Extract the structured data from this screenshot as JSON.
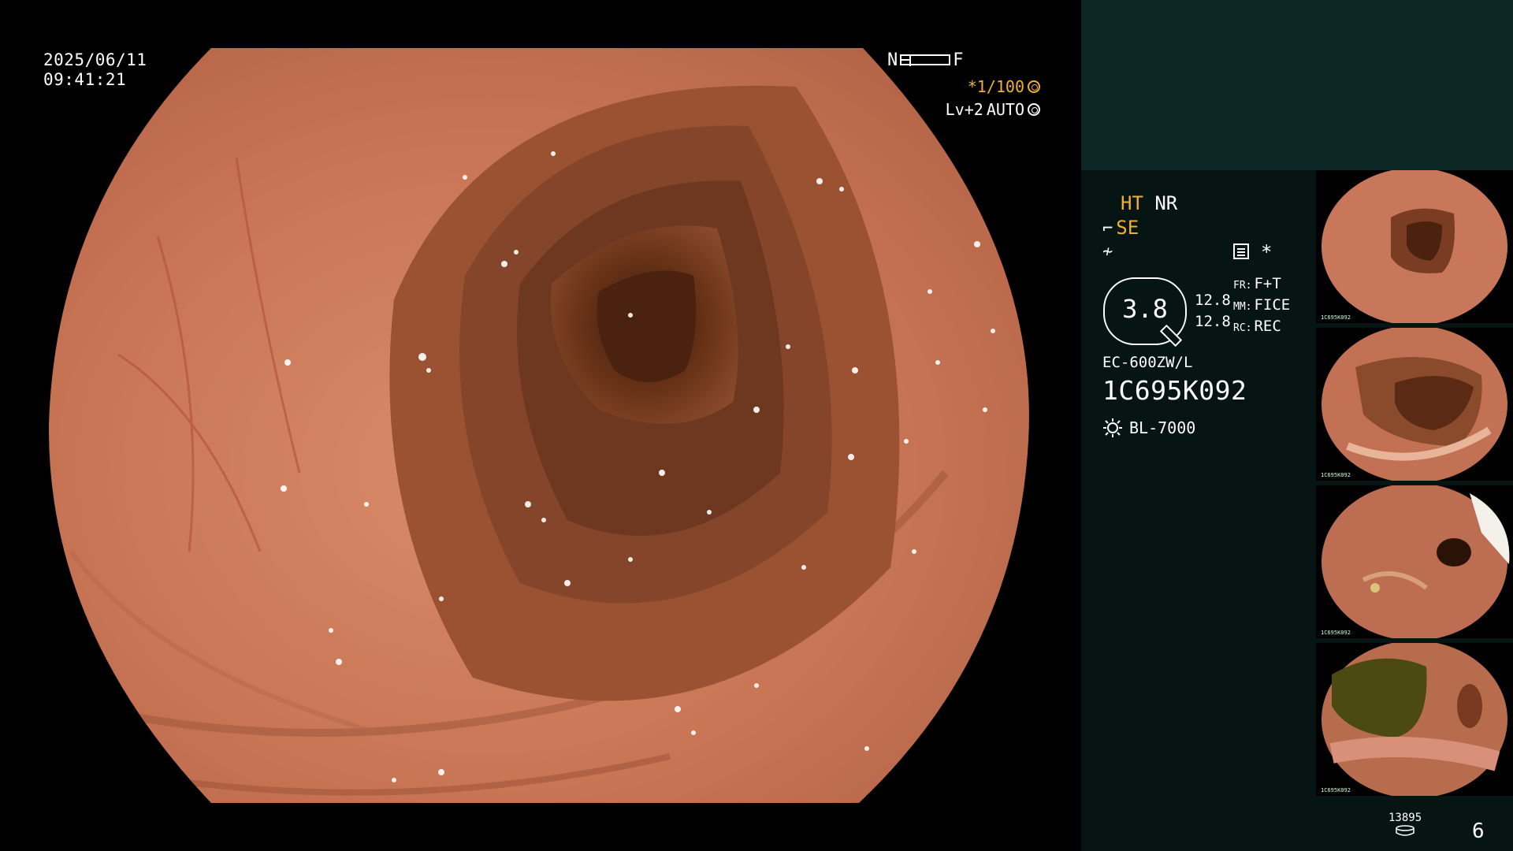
{
  "overlay": {
    "date": "2025/06/11",
    "time": "09:41:21",
    "zoom_near": "N",
    "zoom_far": "F",
    "shutter": "*1/100",
    "level": "Lv+2",
    "exposure_mode": "AUTO"
  },
  "status": {
    "ht": "HT",
    "nr": "NR",
    "se": "SE"
  },
  "gauge": {
    "value": "3.8",
    "upper": "12.8",
    "lower": "12.8"
  },
  "modes": [
    {
      "key": "FR:",
      "value": "F+T"
    },
    {
      "key": "MM:",
      "value": "FICE"
    },
    {
      "key": "RC:",
      "value": "REC"
    }
  ],
  "scope": {
    "model": "EC-600ZW/L",
    "serial": "1C695K092",
    "light_source": "BL-7000"
  },
  "thumbnails": [
    {
      "label": "1C695K092",
      "tone": "#c8775a"
    },
    {
      "label": "1C695K092",
      "tone": "#c27154"
    },
    {
      "label": "1C695K092",
      "tone": "#bd6d52"
    },
    {
      "label": "1C695K092",
      "tone": "#b86c4e"
    }
  ],
  "footer": {
    "capture_count": "13895",
    "page": "6"
  },
  "colors": {
    "accent": "#f2b030",
    "panel": "#071414",
    "panel_header": "#0c2626"
  }
}
